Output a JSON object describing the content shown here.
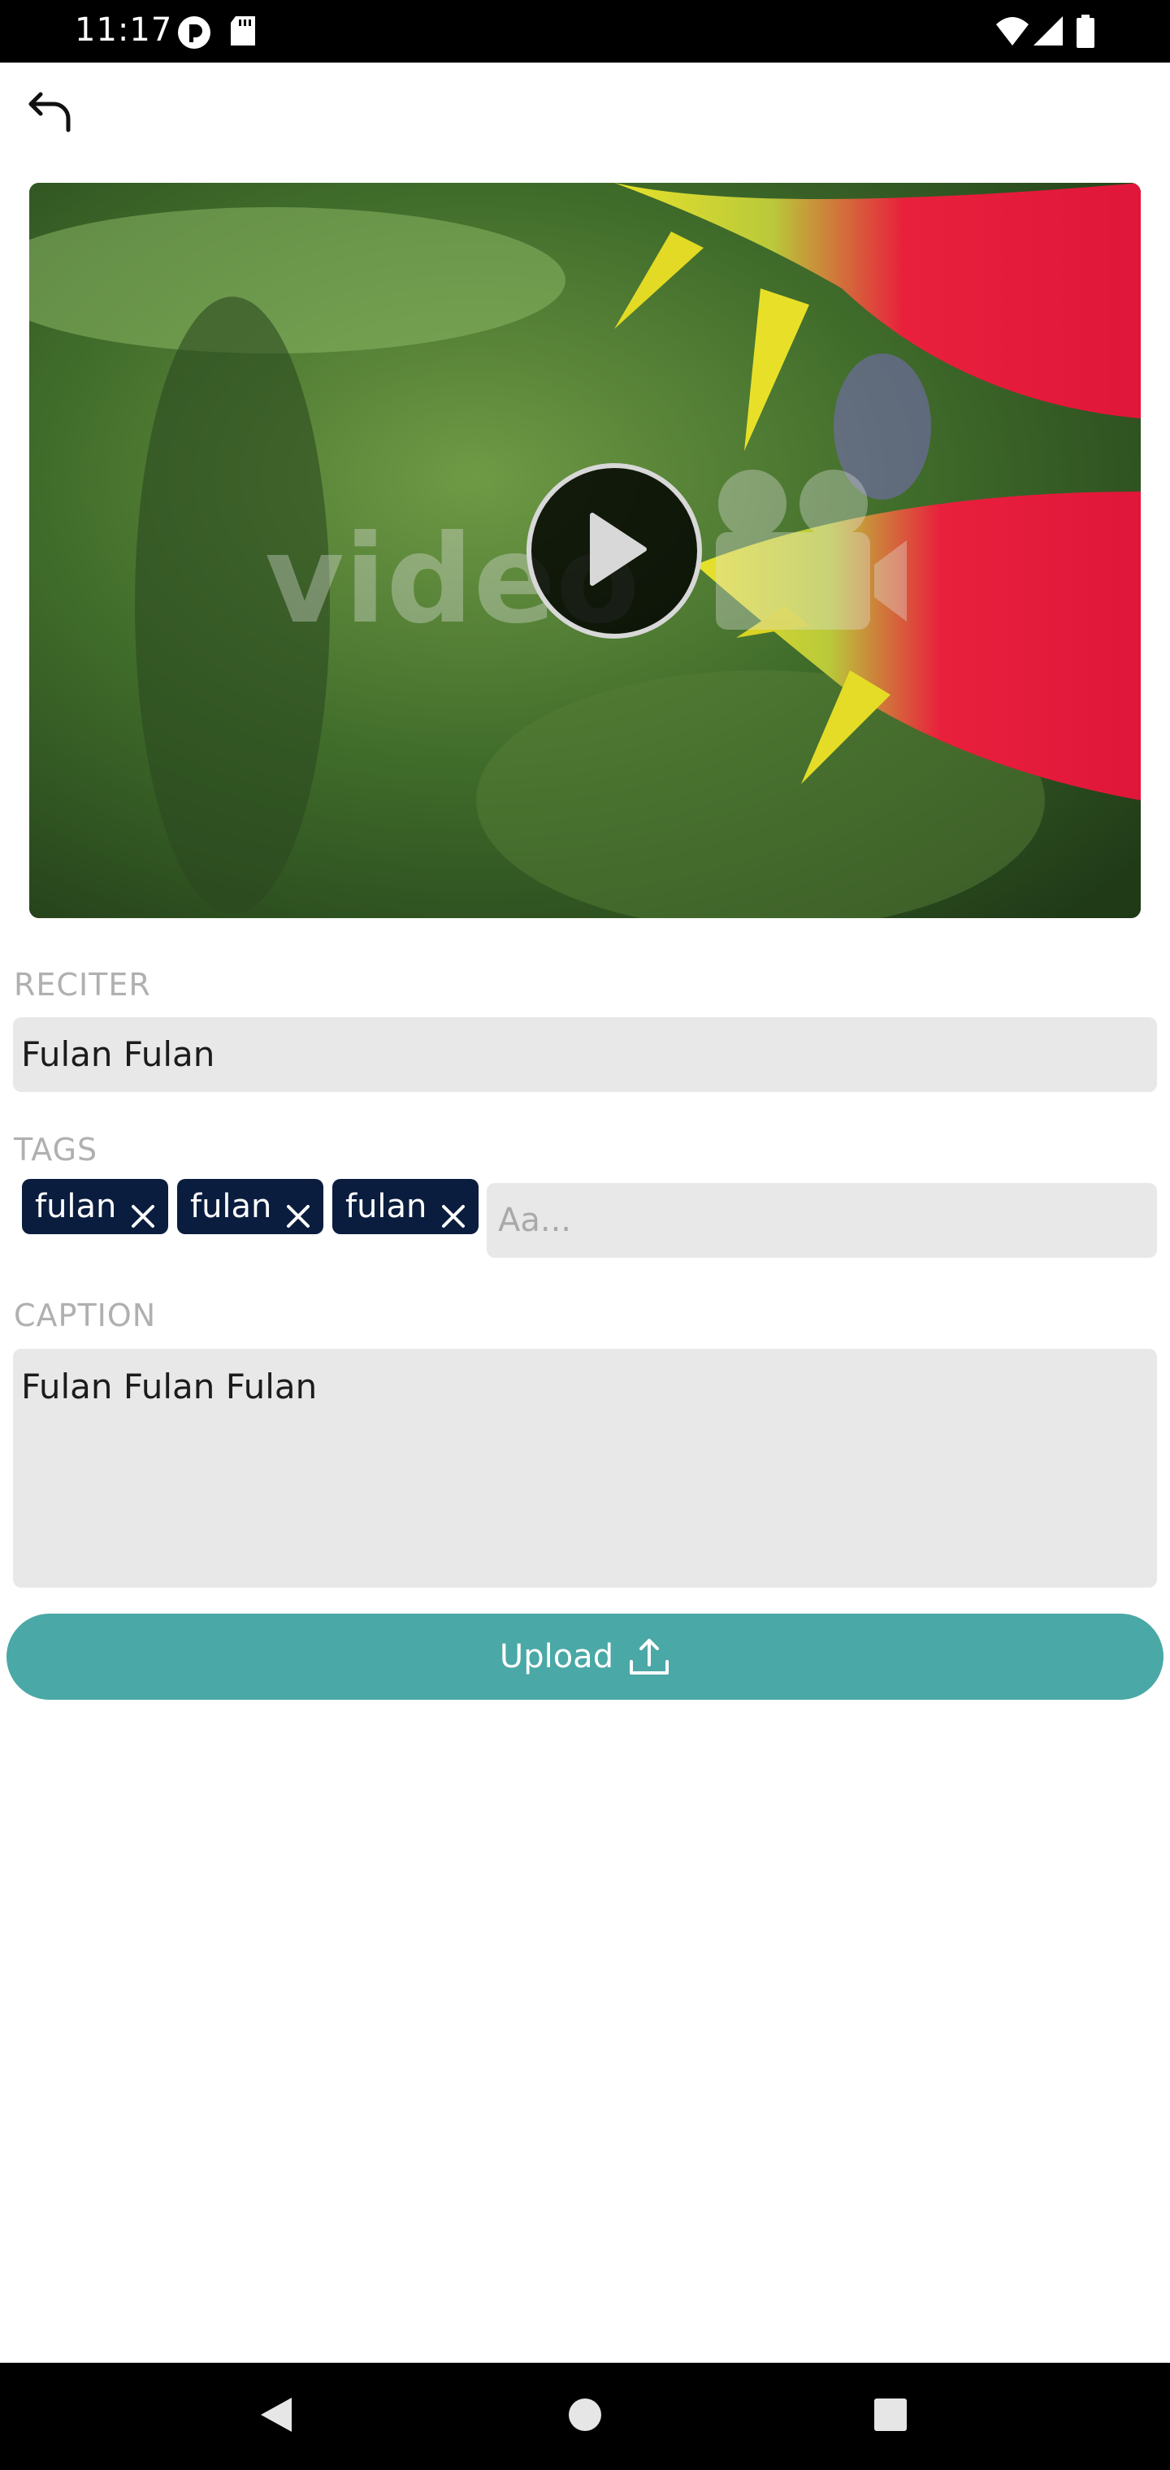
{
  "status_bar": {
    "time": "11:17",
    "left_icons": [
      "pocket-casts-icon",
      "sd-card-icon"
    ],
    "right_icons": [
      "wifi-icon",
      "cellular-signal-icon",
      "battery-icon"
    ]
  },
  "header": {
    "back_icon": "back-arrow-icon"
  },
  "video": {
    "play_icon": "play-icon"
  },
  "form": {
    "reciter": {
      "label": "RECITER",
      "value": "Fulan Fulan"
    },
    "tags": {
      "label": "TAGS",
      "items": [
        "fulan",
        "fulan",
        "fulan"
      ],
      "remove_icon": "close-icon",
      "input_value": "",
      "input_placeholder": "Aa..."
    },
    "caption": {
      "label": "CAPTION",
      "value": "Fulan Fulan Fulan"
    },
    "upload": {
      "label": "Upload",
      "icon": "upload-icon"
    }
  },
  "colors": {
    "accent": "#4aa8a6",
    "tag_bg": "#0b1d3e",
    "field_bg": "#e8e8e8",
    "label": "#b0b0b0"
  },
  "nav_bar": {
    "icons": [
      "nav-back-icon",
      "nav-home-icon",
      "nav-recents-icon"
    ]
  }
}
